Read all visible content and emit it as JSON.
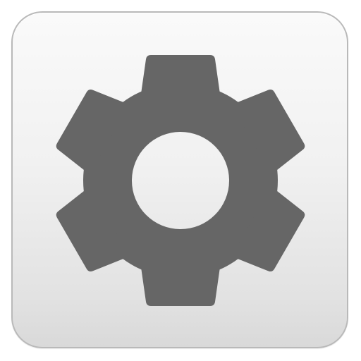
{
  "icon": {
    "name": "gear-icon",
    "colors": {
      "gear": "#666666",
      "gear_hole": "#f2f2f2",
      "tile_border": "#b9b9b9",
      "tile_top": "#fafafa",
      "tile_bottom": "#d9d9d9"
    }
  }
}
